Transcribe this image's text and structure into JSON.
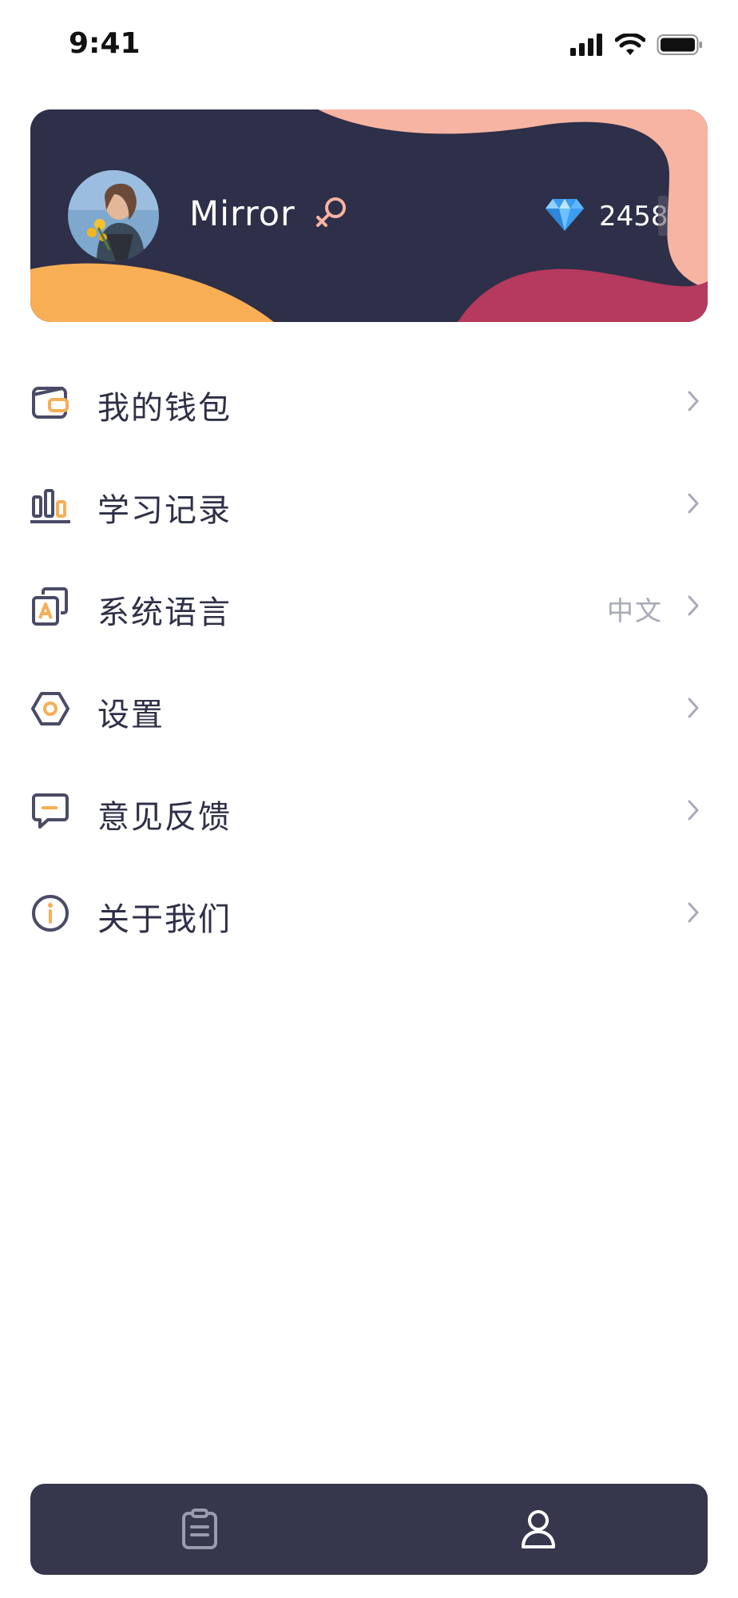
{
  "status_bar": {
    "time": "9:41",
    "icons": [
      "signal-icon",
      "wifi-icon",
      "battery-icon"
    ]
  },
  "profile": {
    "name": "Mirror",
    "gender_icon": "female-symbol-icon",
    "gems": "2458",
    "gem_icon": "diamond-icon"
  },
  "menu": {
    "items": [
      {
        "label": "我的钱包",
        "icon": "wallet-icon"
      },
      {
        "label": "学习记录",
        "icon": "bar-chart-icon"
      },
      {
        "label": "系统语言",
        "icon": "language-icon",
        "value": "中文"
      },
      {
        "label": "设置",
        "icon": "settings-hexagon-icon"
      },
      {
        "label": "意见反馈",
        "icon": "feedback-chat-icon"
      },
      {
        "label": "关于我们",
        "icon": "info-icon"
      }
    ]
  },
  "tab_bar": {
    "tabs": [
      {
        "icon": "clipboard-icon",
        "active": false
      },
      {
        "icon": "user-icon",
        "active": true
      }
    ]
  },
  "colors": {
    "card_dark": "#2e2f48",
    "accent_orange": "#f7ae55",
    "accent_pink": "#f7b4a2",
    "accent_crimson": "#b53a5e",
    "icon_stroke": "#4a4b66",
    "tab_bar": "#36374d"
  }
}
